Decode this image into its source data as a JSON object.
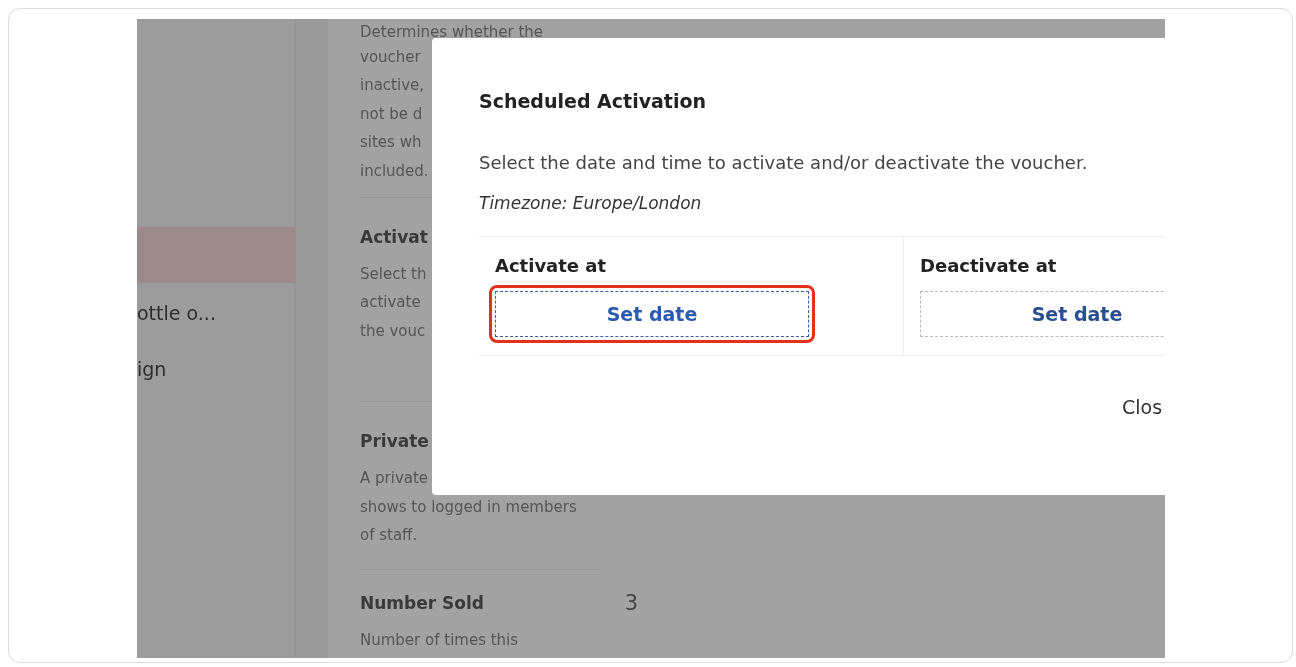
{
  "sidebar": {
    "items": [
      {
        "selected": true
      },
      {
        "label": "ottle o...",
        "selected": false
      },
      {
        "label": "ign",
        "selected": false
      }
    ]
  },
  "sections": [
    {
      "description": [
        "Determines whether the",
        "voucher",
        "inactive,",
        "not be d",
        "sites wh",
        "included."
      ]
    },
    {
      "label": "Activat",
      "description": [
        "Select th",
        "activate",
        "the vouc"
      ]
    },
    {
      "label": "Private",
      "description": [
        "A private",
        "shows to logged in members",
        "of staff."
      ]
    },
    {
      "label": "Number Sold",
      "value": "3",
      "description": [
        "Number of times this"
      ]
    }
  ],
  "dialog": {
    "title": "Scheduled Activation",
    "description": "Select the date and time to activate and/or deactivate the voucher.",
    "timezone": "Timezone: Europe/London",
    "columns": [
      {
        "label": "Activate at",
        "button": "Set date",
        "highlighted": true
      },
      {
        "label": "Deactivate at",
        "button": "Set date",
        "highlighted": false
      }
    ],
    "close_button": "Clos"
  }
}
